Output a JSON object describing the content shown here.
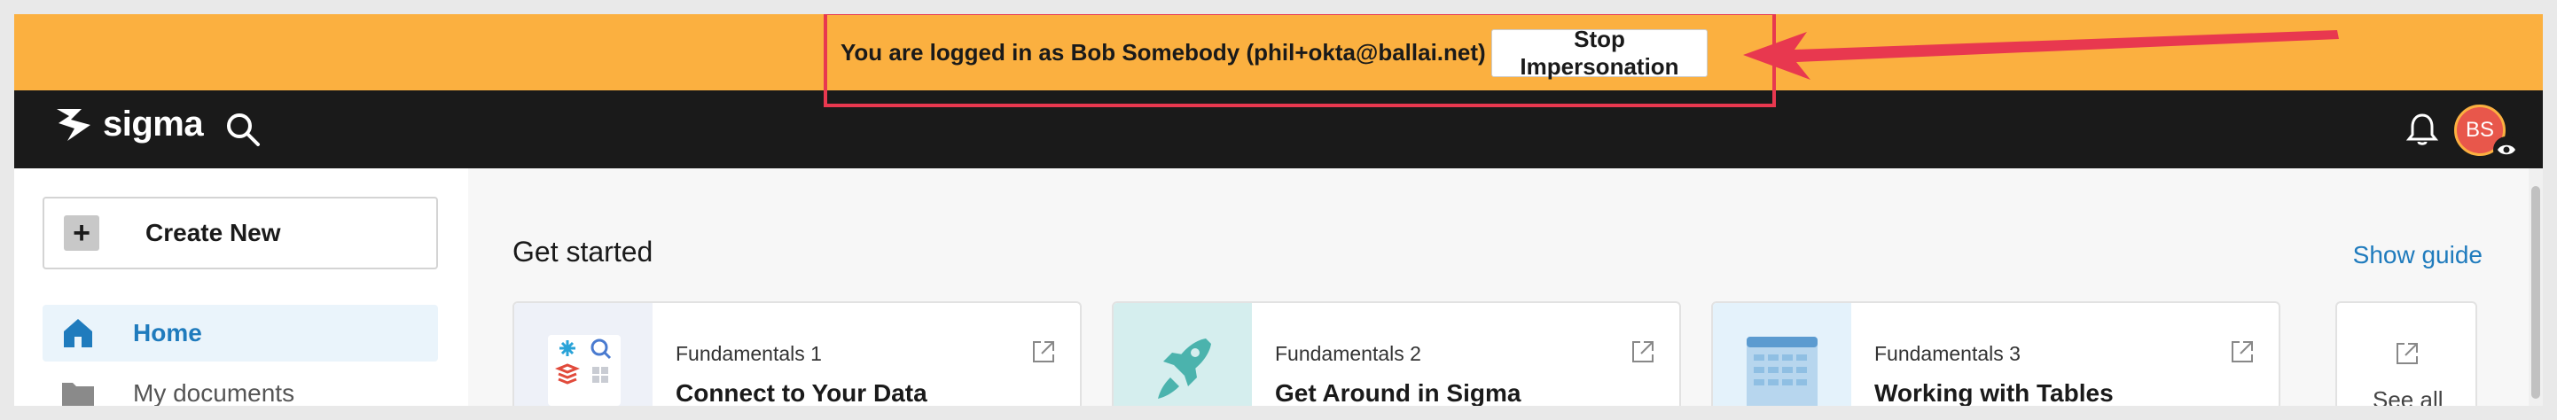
{
  "banner": {
    "message": "You are logged in as Bob Somebody (phil+okta@ballai.net)",
    "stop_button": "Stop Impersonation"
  },
  "navbar": {
    "logo_text": "sigma",
    "avatar_initials": "BS"
  },
  "sidebar": {
    "create_new": "Create New",
    "items": [
      {
        "label": "Home",
        "icon": "home-icon",
        "active": true
      },
      {
        "label": "My documents",
        "icon": "folder-icon",
        "active": false
      }
    ]
  },
  "main": {
    "section_title": "Get started",
    "show_guide": "Show guide",
    "cards": [
      {
        "subtitle": "Fundamentals 1",
        "title": "Connect to Your Data",
        "thumb_color": "#eef1f8"
      },
      {
        "subtitle": "Fundamentals 2",
        "title": "Get Around in Sigma",
        "thumb_color": "#d5eeee"
      },
      {
        "subtitle": "Fundamentals 3",
        "title": "Working with Tables",
        "thumb_color": "#e4f2fb"
      }
    ],
    "see_all": "See all"
  },
  "colors": {
    "banner": "#fbb040",
    "navbar": "#1a1a1a",
    "accent": "#1f7bbd",
    "highlight": "#e8384f",
    "avatar": "#e8574b"
  }
}
